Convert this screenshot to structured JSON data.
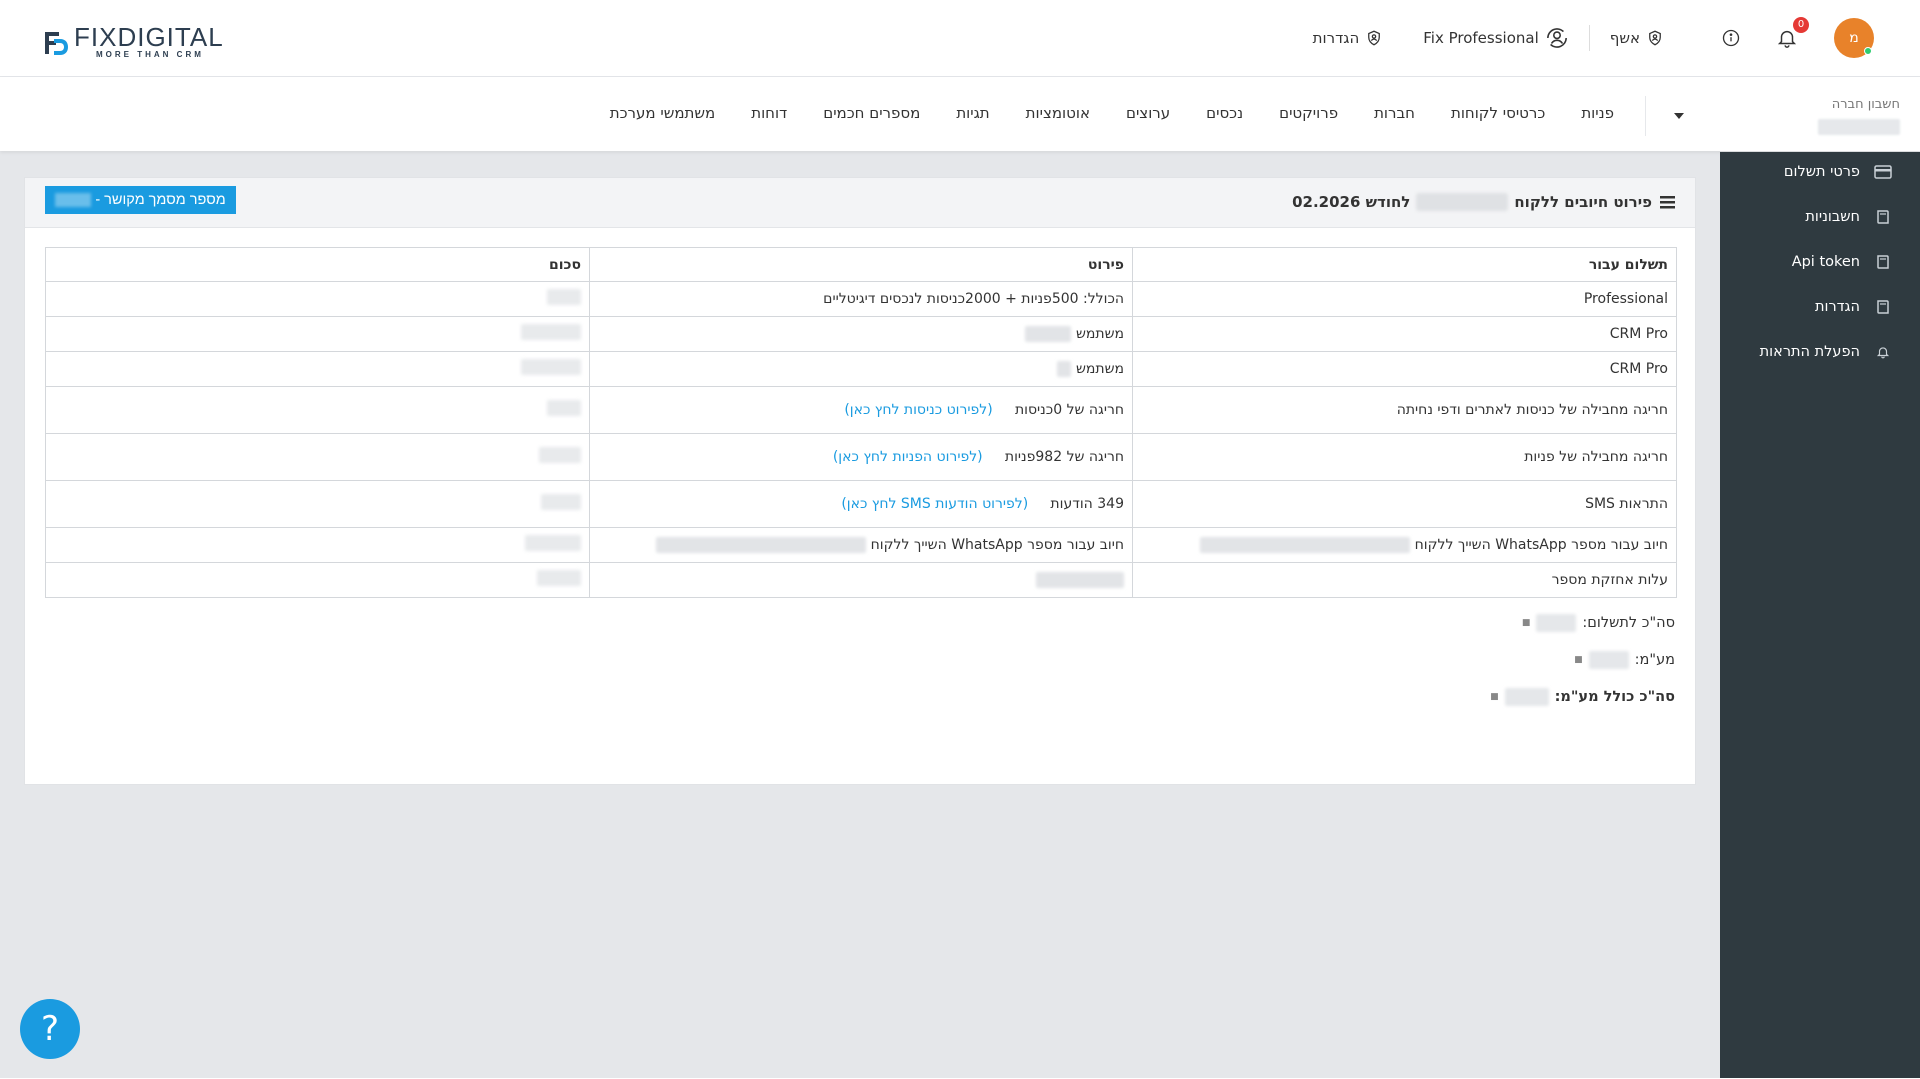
{
  "brand": {
    "name_part1": "FIX",
    "name_part2": "DIGITAL",
    "tagline": "MORE THAN CRM",
    "accent": "#1a9be0"
  },
  "header": {
    "avatar_initial": "מ",
    "notifications_count": "0",
    "user_name": "אשף",
    "professional_label": "Fix Professional",
    "settings_label": "הגדרות"
  },
  "company": {
    "label": "חשבון חברה"
  },
  "menu": [
    "פניות",
    "כרטיסי לקוחות",
    "חברות",
    "פרויקטים",
    "נכסים",
    "ערוצים",
    "אוטומציות",
    "תגיות",
    "מספרים חכמים",
    "דוחות",
    "משתמשי מערכת"
  ],
  "sidebar": [
    {
      "label": "פרטי תשלום",
      "icon": "card-icon"
    },
    {
      "label": "חשבוניות",
      "icon": "book-icon"
    },
    {
      "label": "Api token",
      "icon": "book-icon"
    },
    {
      "label": "הגדרות",
      "icon": "book-icon"
    },
    {
      "label": "הפעלת התראות",
      "icon": "bell-icon"
    }
  ],
  "panel": {
    "title_prefix": "פירוט חיובים ללקוח",
    "title_suffix": "לחודש 02.2026",
    "doc_button": "מספר מסמך מקושר -"
  },
  "table": {
    "headers": [
      "תשלום עבור",
      "פירוט",
      "סכום"
    ],
    "rows": [
      {
        "for": "Professional",
        "detail": "הכולל: 500פניות + 2000כניסות לנכסים דיגיטליים",
        "link": ""
      },
      {
        "for": "CRM Pro",
        "detail": "משתמש",
        "link": ""
      },
      {
        "for": "CRM Pro",
        "detail": "משתמש",
        "link": ""
      },
      {
        "for": "חריגה מחבילה של כניסות לאתרים ודפי נחיתה",
        "detail": "חריגה של 0כניסות",
        "link": "(לפירוט כניסות לחץ כאן)"
      },
      {
        "for": "חריגה מחבילה של פניות",
        "detail": "חריגה של 982פניות",
        "link": "(לפירוט הפניות לחץ כאן)"
      },
      {
        "for": "התראות SMS",
        "detail": "349 הודעות",
        "link": "(לפירוט הודעות SMS לחץ כאן)"
      },
      {
        "for": "חיוב עבור מספר WhatsApp השייך ללקוח",
        "detail": "חיוב עבור מספר WhatsApp השייך ללקוח",
        "link": ""
      },
      {
        "for": "עלות אחזקת מספר",
        "detail": "",
        "link": ""
      }
    ]
  },
  "totals": {
    "subtotal_label": "סה\"כ לתשלום:",
    "vat_label": "מע\"מ:",
    "total_label": "סה\"כ כולל מע\"מ:"
  },
  "help": {
    "label": "?"
  }
}
